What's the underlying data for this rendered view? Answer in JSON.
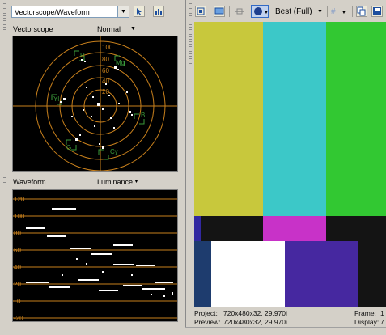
{
  "left_panel": {
    "tool_combo": "Vectorscope/Waveform",
    "vectorscope": {
      "title": "Vectorscope",
      "mode": "Normal",
      "scale_labels": [
        "100",
        "80",
        "60",
        "40",
        "20"
      ],
      "targets": [
        "R",
        "Mg",
        "B",
        "Cy",
        "G",
        "Yl"
      ]
    },
    "waveform": {
      "title": "Waveform",
      "mode": "Luminance",
      "scale_labels": [
        "120",
        "100",
        "80",
        "60",
        "40",
        "20",
        "0",
        "-20"
      ]
    }
  },
  "right_panel": {
    "quality": "Best (Full)",
    "status": {
      "project_label": "Project:",
      "project_value": "720x480x32, 29.970i",
      "preview_label": "Preview:",
      "preview_value": "720x480x32, 29.970i",
      "frame_label": "Frame:",
      "frame_value": "1",
      "display_label": "Display:",
      "display_value": "7"
    }
  },
  "colors": {
    "panel_bg": "#d4d0c8",
    "scope_bg": "#000000",
    "graticule": "#c8801c",
    "target_green": "#3a9a3a",
    "trace_white": "#ffffff"
  },
  "bars": {
    "top": [
      "#c8c83c",
      "#3cc8c8",
      "#32c832"
    ],
    "middle": [
      "#3228a0",
      "#141414",
      "#c832c8",
      "#141414"
    ],
    "bottom": [
      "#1e3c6e",
      "#ffffff",
      "#4628a0",
      "#141414"
    ]
  }
}
